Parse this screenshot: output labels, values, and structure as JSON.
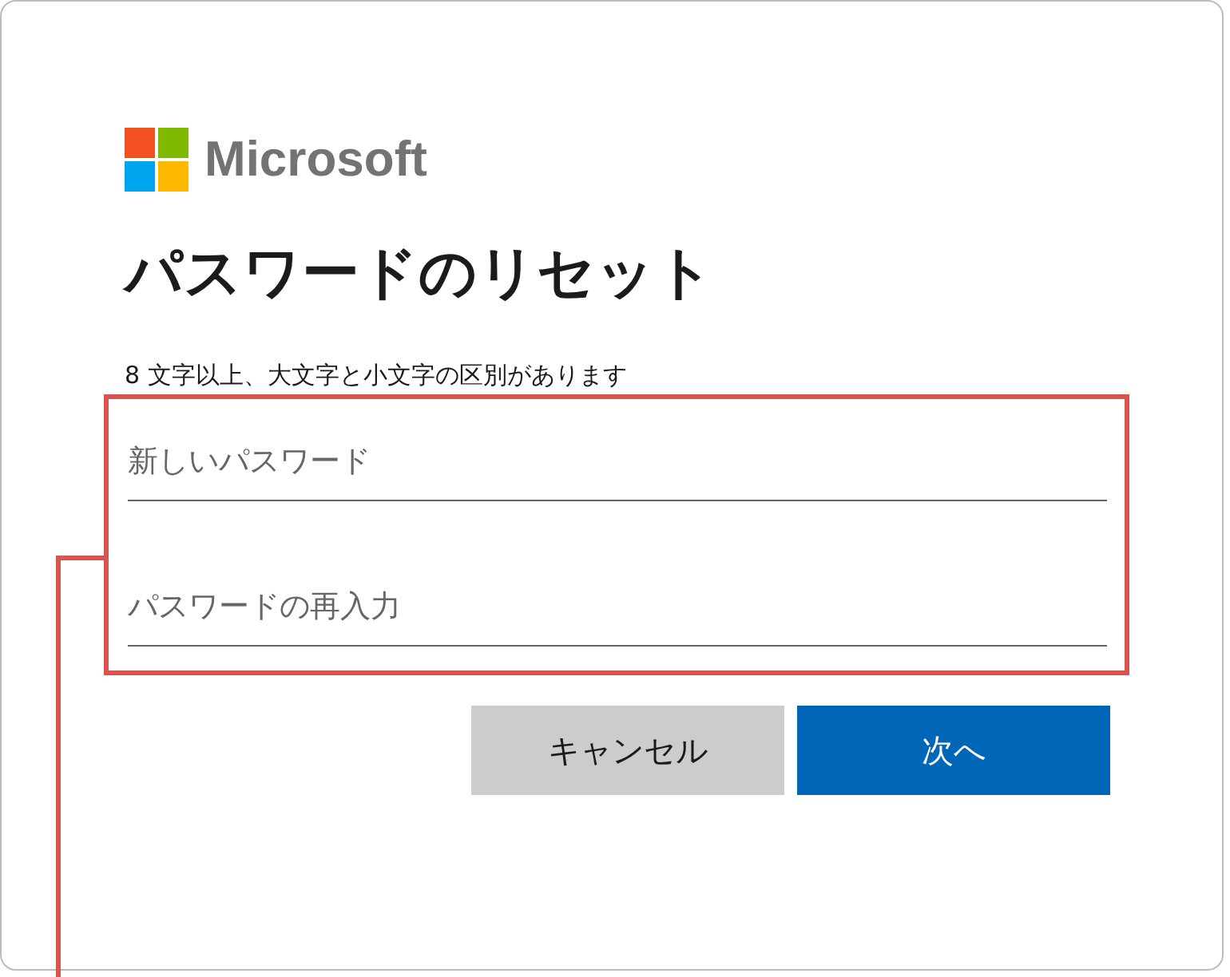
{
  "logo": {
    "text": "Microsoft"
  },
  "title": "パスワードのリセット",
  "hint": "8 文字以上、大文字と小文字の区別があります",
  "fields": [
    {
      "placeholder": "新しいパスワード"
    },
    {
      "placeholder": "パスワードの再入力"
    }
  ],
  "buttons": [
    {
      "label": "キャンセル",
      "kind": "secondary"
    },
    {
      "label": "次へ",
      "kind": "primary"
    }
  ]
}
